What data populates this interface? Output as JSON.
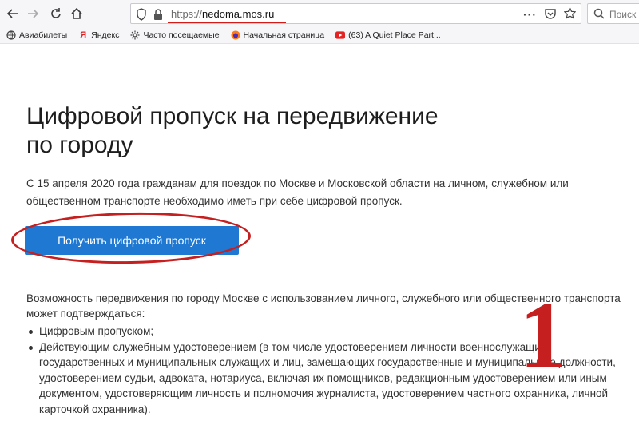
{
  "browser": {
    "url_scheme": "https://",
    "url_host": "nedoma.mos.ru",
    "search_placeholder": "Поиск",
    "icons": {
      "back": "arrow-left-icon",
      "forward": "arrow-right-icon",
      "reload": "reload-icon",
      "home": "home-icon",
      "shield": "shield-icon",
      "lock": "lock-icon",
      "menu": "more-dots-icon",
      "pocket": "pocket-icon",
      "bookmark": "star-icon",
      "search": "search-icon"
    }
  },
  "bookmarks": [
    {
      "label": "Авиабилеты",
      "icon": "globe-icon"
    },
    {
      "label": "Яндекс",
      "icon": "yandex-icon"
    },
    {
      "label": "Часто посещаемые",
      "icon": "gear-icon"
    },
    {
      "label": "Начальная страница",
      "icon": "firefox-icon"
    },
    {
      "label": "(63) A Quiet Place Part...",
      "icon": "youtube-icon"
    }
  ],
  "page": {
    "title_line1": "Цифровой пропуск на передвижение",
    "title_line2": "по городу",
    "intro": "С 15 апреля 2020 года гражданам для поездок по Москве и Московской области на личном, служебном или общественном транспорте необходимо иметь при себе цифровой пропуск.",
    "cta_label": "Получить цифровой пропуск",
    "para": "Возможность передвижения по городу Москве с использованием личного, служебного или общественного транспорта может подтверждаться:",
    "bullet1": "Цифровым пропуском;",
    "bullet2": "Действующим служебным удостоверением (в том числе удостоверением личности военнослужащих, государственных и муниципальных служащих и лиц, замещающих государственные и муниципальные должности, удостоверением судьи, адвоката, нотариуса, включая их помощников, редакционным удостоверением или иным документом, удостоверяющим личность и полномочия журналиста, удостоверением частного охранника, личной карточкой охранника)."
  },
  "annotation": {
    "number": "1",
    "color": "#c51f1f"
  },
  "colors": {
    "accent": "#1f78d1",
    "annotation": "#c51f1f"
  }
}
